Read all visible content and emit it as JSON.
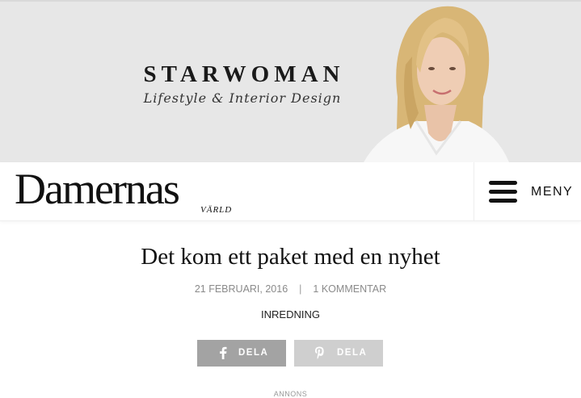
{
  "banner": {
    "title": "STARWOMAN",
    "tagline": "Lifestyle & Interior Design"
  },
  "header": {
    "logo_main": "Damernas",
    "logo_sub": "VÄRLD",
    "menu_label": "MENY"
  },
  "article": {
    "title": "Det kom ett paket med en nyhet",
    "date": "21 FEBRUARI, 2016",
    "separator": "|",
    "comments": "1 KOMMENTAR",
    "category": "INREDNING"
  },
  "share": {
    "facebook_label": "DELA",
    "pinterest_label": "DELA"
  },
  "ad": {
    "label": "ANNONS"
  },
  "colors": {
    "banner_bg": "#e7e7e7",
    "facebook_button": "#a3a3a3",
    "pinterest_button": "#cfcfcf",
    "meta_text": "#8a8a8a"
  },
  "icons": {
    "facebook": "facebook-icon",
    "pinterest": "pinterest-icon",
    "menu": "hamburger-icon"
  }
}
